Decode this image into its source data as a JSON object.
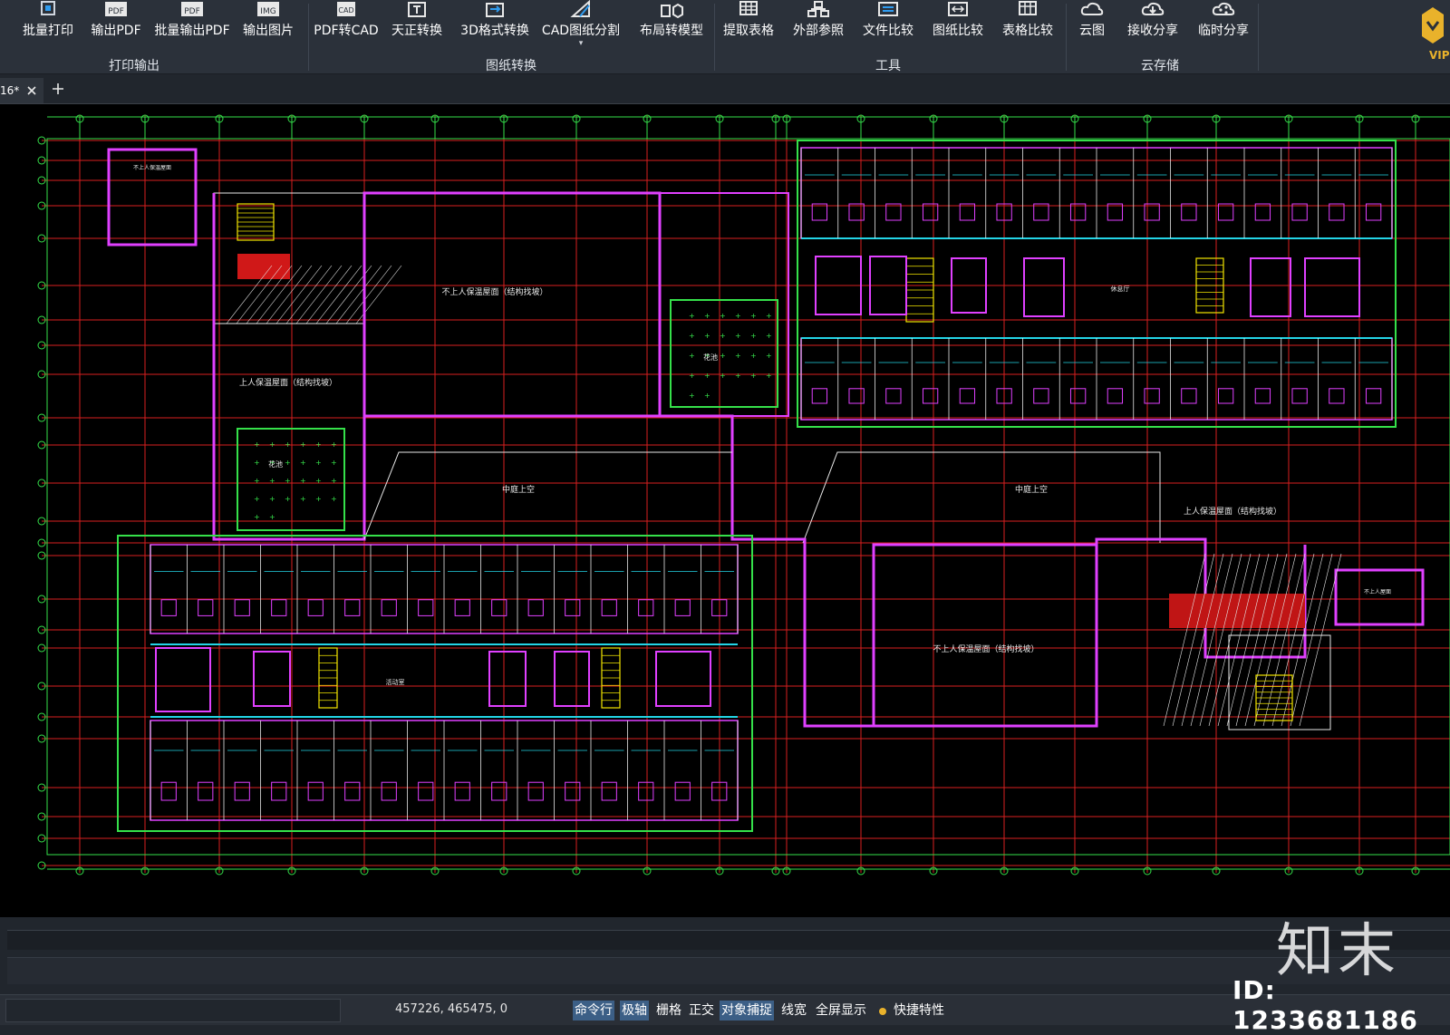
{
  "ribbon": {
    "buttons": [
      {
        "label": "批量打印",
        "icon": "batch-print-icon"
      },
      {
        "label": "输出PDF",
        "icon": "pdf-output-icon"
      },
      {
        "label": "批量输出PDF",
        "icon": "batch-pdf-icon"
      },
      {
        "label": "输出图片",
        "icon": "image-output-icon"
      },
      {
        "label": "PDF转CAD",
        "icon": "pdf-to-cad-icon"
      },
      {
        "label": "天正转换",
        "icon": "tangent-convert-icon"
      },
      {
        "label": "3D格式转换",
        "icon": "3d-convert-icon"
      },
      {
        "label": "CAD图纸分割",
        "icon": "split-drawing-icon"
      },
      {
        "label": "布局转模型",
        "icon": "layout-to-model-icon"
      },
      {
        "label": "提取表格",
        "icon": "extract-table-icon"
      },
      {
        "label": "外部参照",
        "icon": "xref-icon"
      },
      {
        "label": "文件比较",
        "icon": "file-compare-icon"
      },
      {
        "label": "图纸比较",
        "icon": "drawing-compare-icon"
      },
      {
        "label": "表格比较",
        "icon": "table-compare-icon"
      },
      {
        "label": "云图",
        "icon": "cloud-icon"
      },
      {
        "label": "接收分享",
        "icon": "receive-share-icon"
      },
      {
        "label": "临时分享",
        "icon": "temp-share-icon"
      }
    ],
    "groups": [
      "打印输出",
      "图纸转换",
      "工具",
      "云存储"
    ],
    "pdf_badge": "PDF",
    "img_badge": "IMG",
    "cad_badge": "CAD",
    "vip_label": "VIP"
  },
  "tabs": {
    "active_title": "16*",
    "add_icon": "plus-icon",
    "close_icon": "close-icon"
  },
  "drawing": {
    "labels": {
      "roof_no_access_1": "不上人保温屋面（结构找坡）",
      "roof_access_1": "上人保温屋面（结构找坡）",
      "garden_1": "花池",
      "garden_2": "花池",
      "courtyard_1": "中庭上空",
      "courtyard_2": "中庭上空",
      "roof_access_2": "上人保温屋面（结构找坡）",
      "roof_no_access_2": "不上人保温屋面（结构找坡）",
      "lounge": "休息厅",
      "activity": "活动室",
      "corner_note_1": "不上人保温屋面",
      "corner_note_2": "不上人屋面"
    }
  },
  "statusbar": {
    "coordinates": "457226, 465475, 0",
    "items": [
      {
        "label": "命令行",
        "on": true
      },
      {
        "label": "极轴",
        "on": true
      },
      {
        "label": "栅格",
        "on": false
      },
      {
        "label": "正交",
        "on": false
      },
      {
        "label": "对象捕捉",
        "on": true
      },
      {
        "label": "线宽",
        "on": false
      },
      {
        "label": "全屏显示",
        "on": false
      },
      {
        "label": "快捷特性",
        "on": false
      }
    ]
  },
  "watermark": {
    "logo": "知末",
    "id": "ID: 1233681186"
  },
  "colors": {
    "grid_red": "#d81f1f",
    "axis_green": "#35e04a",
    "wall_magenta": "#e040ff",
    "cyan": "#23d4e6",
    "white_line": "#e8e8e8",
    "yellow": "#f2e600"
  }
}
